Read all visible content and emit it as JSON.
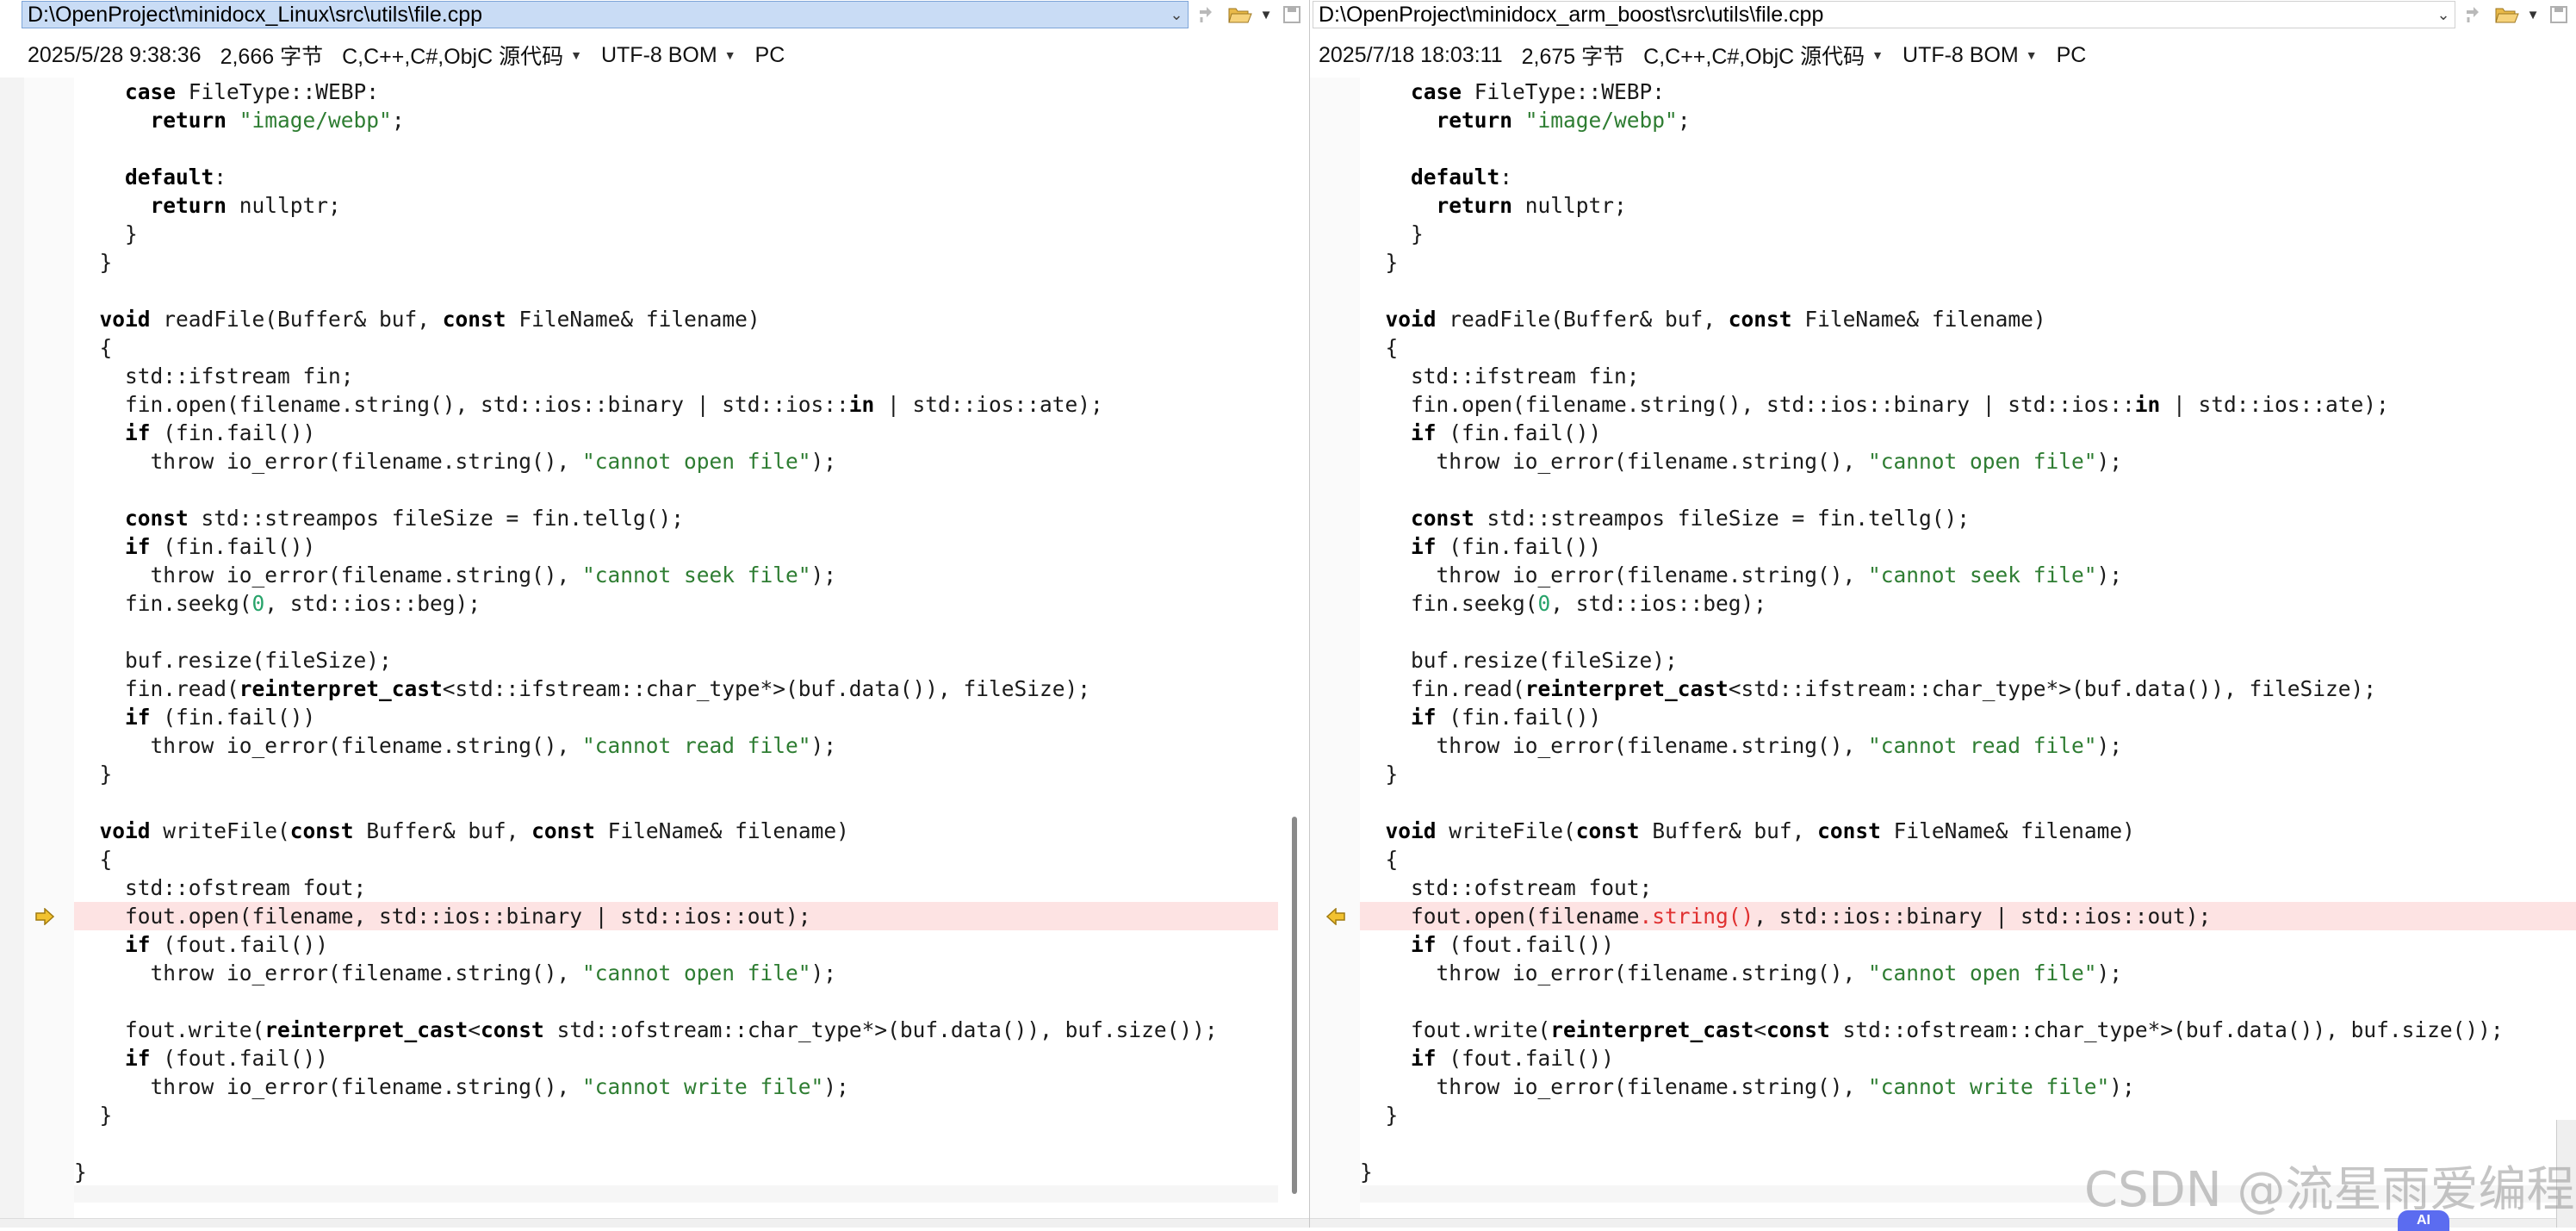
{
  "left": {
    "path": "D:\\OpenProject\\minidocx_Linux\\src\\utils\\file.cpp",
    "info": {
      "datetime": "2025/5/28 9:38:36",
      "size": "2,666 字节",
      "language": "C,C++,C#,ObjC 源代码",
      "encoding": "UTF-8 BOM",
      "line_ending": "PC"
    }
  },
  "right": {
    "path": "D:\\OpenProject\\minidocx_arm_boost\\src\\utils\\file.cpp",
    "info": {
      "datetime": "2025/7/18 18:03:11",
      "size": "2,675 字节",
      "language": "C,C++,C#,ObjC 源代码",
      "encoding": "UTF-8 BOM",
      "line_ending": "PC"
    }
  },
  "code_common": [
    [
      {
        "t": "    "
      },
      {
        "t": "case",
        "c": "kw"
      },
      {
        "t": " FileType::WEBP:"
      }
    ],
    [
      {
        "t": "      "
      },
      {
        "t": "return",
        "c": "kw"
      },
      {
        "t": " "
      },
      {
        "t": "\"image/webp\"",
        "c": "str"
      },
      {
        "t": ";"
      }
    ],
    [
      {
        "t": ""
      }
    ],
    [
      {
        "t": "    "
      },
      {
        "t": "default",
        "c": "kw"
      },
      {
        "t": ":"
      }
    ],
    [
      {
        "t": "      "
      },
      {
        "t": "return",
        "c": "kw"
      },
      {
        "t": " nullptr;"
      }
    ],
    [
      {
        "t": "    }"
      }
    ],
    [
      {
        "t": "  }"
      }
    ],
    [
      {
        "t": ""
      }
    ],
    [
      {
        "t": "  "
      },
      {
        "t": "void",
        "c": "kw"
      },
      {
        "t": " readFile(Buffer& buf, "
      },
      {
        "t": "const",
        "c": "kw"
      },
      {
        "t": " FileName& filename)"
      }
    ],
    [
      {
        "t": "  {"
      }
    ],
    [
      {
        "t": "    std::ifstream fin;"
      }
    ],
    [
      {
        "t": "    fin.open(filename.string(), std::ios::binary | std::ios::"
      },
      {
        "t": "in",
        "c": "kw"
      },
      {
        "t": " | std::ios::ate);"
      }
    ],
    [
      {
        "t": "    "
      },
      {
        "t": "if",
        "c": "kw"
      },
      {
        "t": " (fin.fail())"
      }
    ],
    [
      {
        "t": "      throw io_error(filename.string(), "
      },
      {
        "t": "\"cannot open file\"",
        "c": "str"
      },
      {
        "t": ");"
      }
    ],
    [
      {
        "t": ""
      }
    ],
    [
      {
        "t": "    "
      },
      {
        "t": "const",
        "c": "kw"
      },
      {
        "t": " std::streampos fileSize = fin.tellg();"
      }
    ],
    [
      {
        "t": "    "
      },
      {
        "t": "if",
        "c": "kw"
      },
      {
        "t": " (fin.fail())"
      }
    ],
    [
      {
        "t": "      throw io_error(filename.string(), "
      },
      {
        "t": "\"cannot seek file\"",
        "c": "str"
      },
      {
        "t": ");"
      }
    ],
    [
      {
        "t": "    fin.seekg("
      },
      {
        "t": "0",
        "c": "num"
      },
      {
        "t": ", std::ios::beg);"
      }
    ],
    [
      {
        "t": ""
      }
    ],
    [
      {
        "t": "    buf.resize(fileSize);"
      }
    ],
    [
      {
        "t": "    fin.read("
      },
      {
        "t": "reinterpret_cast",
        "c": "kw"
      },
      {
        "t": "<std::ifstream::char_type*>(buf.data()), fileSize);"
      }
    ],
    [
      {
        "t": "    "
      },
      {
        "t": "if",
        "c": "kw"
      },
      {
        "t": " (fin.fail())"
      }
    ],
    [
      {
        "t": "      throw io_error(filename.string(), "
      },
      {
        "t": "\"cannot read file\"",
        "c": "str"
      },
      {
        "t": ");"
      }
    ],
    [
      {
        "t": "  }"
      }
    ],
    [
      {
        "t": ""
      }
    ],
    [
      {
        "t": "  "
      },
      {
        "t": "void",
        "c": "kw"
      },
      {
        "t": " writeFile("
      },
      {
        "t": "const",
        "c": "kw"
      },
      {
        "t": " Buffer& buf, "
      },
      {
        "t": "const",
        "c": "kw"
      },
      {
        "t": " FileName& filename)"
      }
    ],
    [
      {
        "t": "  {"
      }
    ],
    [
      {
        "t": "    std::ofstream fout;"
      }
    ],
    "DIFF",
    [
      {
        "t": "    "
      },
      {
        "t": "if",
        "c": "kw"
      },
      {
        "t": " (fout.fail())"
      }
    ],
    [
      {
        "t": "      throw io_error(filename.string(), "
      },
      {
        "t": "\"cannot open file\"",
        "c": "str"
      },
      {
        "t": ");"
      }
    ],
    [
      {
        "t": ""
      }
    ],
    [
      {
        "t": "    fout.write("
      },
      {
        "t": "reinterpret_cast",
        "c": "kw"
      },
      {
        "t": "<"
      },
      {
        "t": "const",
        "c": "kw"
      },
      {
        "t": " std::ofstream::char_type*>(buf.data()), buf.size());"
      }
    ],
    [
      {
        "t": "    "
      },
      {
        "t": "if",
        "c": "kw"
      },
      {
        "t": " (fout.fail())"
      }
    ],
    [
      {
        "t": "      throw io_error(filename.string(), "
      },
      {
        "t": "\"cannot write file\"",
        "c": "str"
      },
      {
        "t": ");"
      }
    ],
    [
      {
        "t": "  }"
      }
    ],
    [
      {
        "t": ""
      }
    ],
    [
      {
        "t": "}"
      }
    ]
  ],
  "left_diff_line": [
    {
      "t": "    fout.open(filename, std::ios::binary | std::ios::out);"
    }
  ],
  "right_diff_line": [
    {
      "t": "    fout.open(filename"
    },
    {
      "t": ".string()",
      "c": "chg"
    },
    {
      "t": ", std::ios::binary | std::ios::out);"
    }
  ],
  "watermark": "CSDN @流星雨爱编程",
  "ai_badge": "AI",
  "icons": {
    "path_dropdown": "chevron-down-icon",
    "reload": "reload-icon",
    "open_folder": "open-folder-icon",
    "save": "save-icon",
    "left_marker": "arrow-right-icon",
    "right_marker": "arrow-left-icon"
  },
  "colors": {
    "diff_bg": "#fde3e3",
    "string": "#2e7d32",
    "number": "#27a36a",
    "change": "#e03030",
    "selected_path_bg": "#c9dcf5",
    "marker": "#e8b21a"
  }
}
